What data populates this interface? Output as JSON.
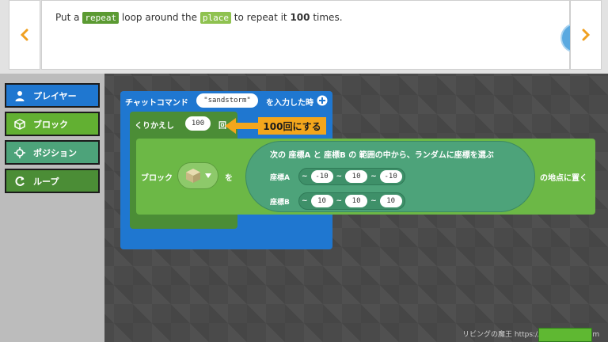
{
  "instruction": {
    "before": "Put a ",
    "repeat_tag": "repeat",
    "middle": " loop around the ",
    "place_tag": "place",
    "after": " to repeat it ",
    "count": "100",
    "end": " times."
  },
  "categories": [
    {
      "label": "プレイヤー",
      "icon": "player-icon",
      "color": "#1f77d0"
    },
    {
      "label": "ブロック",
      "icon": "cube-icon",
      "color": "#62b032"
    },
    {
      "label": "ポジション",
      "icon": "crosshair-icon",
      "color": "#4da37a"
    },
    {
      "label": "ループ",
      "icon": "loop-icon",
      "color": "#4b8d36"
    }
  ],
  "event_block": {
    "label": "チャットコマンド",
    "command": "\"sandstorm\"",
    "suffix": "を入力した時"
  },
  "repeat_block": {
    "label": "くりかえし",
    "count": "100",
    "unit": "回"
  },
  "callout": {
    "text": "100回にする",
    "color": "#f3a61c"
  },
  "place_block": {
    "label": "ブロック",
    "wo": "を",
    "suffix": "の地点に置く",
    "random": {
      "title": "次の 座標A と 座標B の 範囲の中から、ランダムに座標を選ぶ",
      "posA_label": "座標A",
      "posB_label": "座標B",
      "posA": [
        "-10",
        "10",
        "-10"
      ],
      "posB": [
        "10",
        "10",
        "10"
      ],
      "tilde": "~"
    }
  },
  "watermark": "リビングの魔王 https://living-maou.com"
}
